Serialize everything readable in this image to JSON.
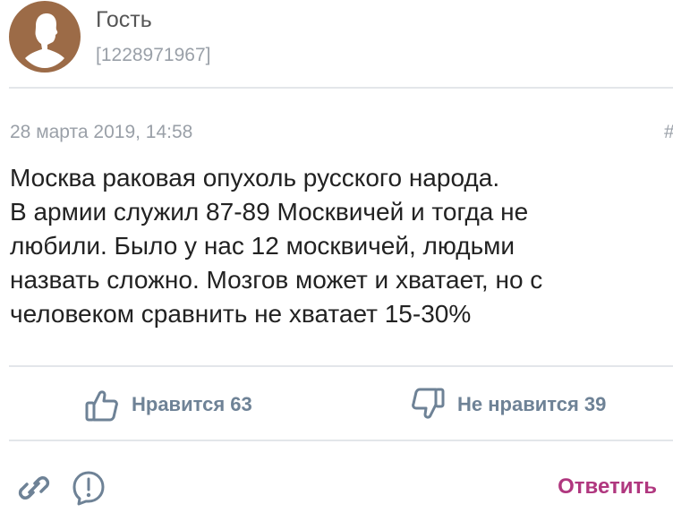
{
  "author": {
    "name": "Гость",
    "id": "[1228971967]",
    "avatar_icon": "person-silhouette-icon",
    "avatar_color": "#9c6b47"
  },
  "post": {
    "date": "28 марта 2019, 14:58",
    "hash_mark": "#",
    "text_lines": [
      "Москва раковая опухоль русского народа.",
      "В армии служил 87-89 Москвичей и тогда не",
      "любили. Было у нас 12 москвичей, людьми",
      "назвать сложно. Мозгов может и хватает, но с",
      "человеком сравнить не хватает 15-30%"
    ]
  },
  "reactions": {
    "like": {
      "icon": "thumbs-up-icon",
      "label": "Нравится 63"
    },
    "dislike": {
      "icon": "thumbs-down-icon",
      "label": "Не нравится 39"
    }
  },
  "footer": {
    "link_icon": "link-icon",
    "report_icon": "report-icon",
    "reply_label": "Ответить"
  },
  "colors": {
    "accent": "#b0377f",
    "reaction": "#6e8296",
    "meta": "#9aa0a8"
  }
}
